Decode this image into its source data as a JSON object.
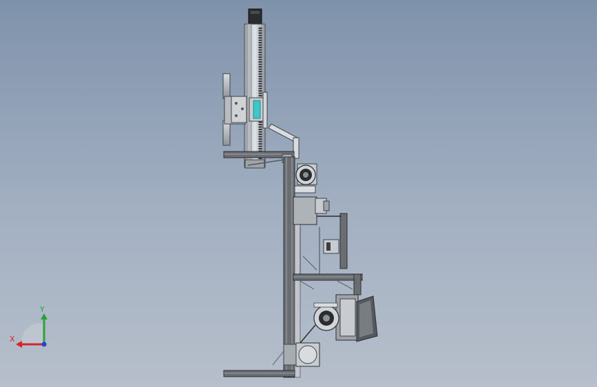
{
  "viewport": {
    "background_top": "#7f92ab",
    "background_bottom": "#b6bfcb"
  },
  "triad": {
    "x_label": "X",
    "y_label": "Y",
    "x_color": "#d8222a",
    "y_color": "#2aa43a",
    "z_color": "#2244cc"
  },
  "colors": {
    "steel": "#c4c8cc",
    "steel_dark": "#55595e",
    "extrusion": "#6a6e72",
    "accent_cyan": "#3fc7c7",
    "motor_black": "#2a2c2e"
  }
}
